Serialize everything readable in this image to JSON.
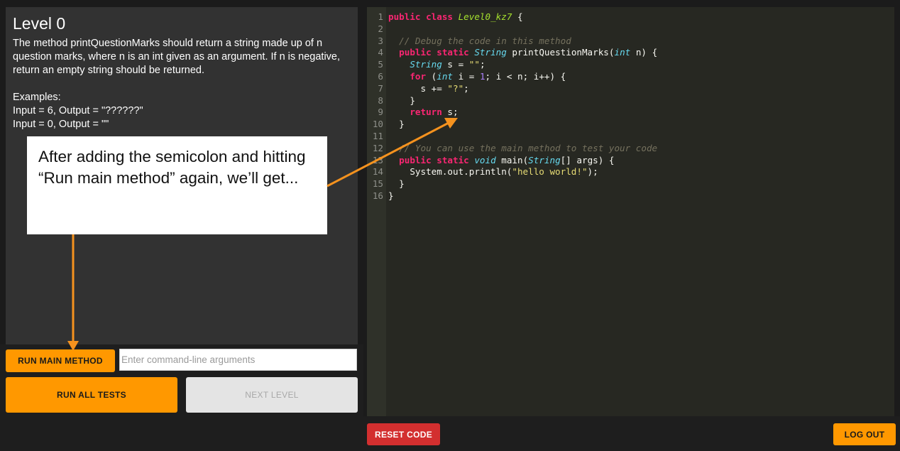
{
  "level": {
    "title": "Level 0",
    "description": "The method printQuestionMarks should return a string made up of n question marks, where n is an int given as an argument. If n is negative, return an empty string should be returned.\n\nExamples:\nInput = 6, Output = \"??????\"\nInput = 0, Output = \"\""
  },
  "controls": {
    "run_main_label": "RUN MAIN METHOD",
    "args_placeholder": "Enter command-line arguments",
    "run_tests_label": "RUN ALL TESTS",
    "next_level_label": "NEXT LEVEL"
  },
  "editor": {
    "lines": [
      {
        "n": "1",
        "tokens": [
          [
            "kw",
            "public "
          ],
          [
            "kw",
            "class "
          ],
          [
            "cl",
            "Level0_kz7"
          ],
          [
            "pl",
            " {"
          ]
        ]
      },
      {
        "n": "2",
        "tokens": []
      },
      {
        "n": "3",
        "tokens": [
          [
            "pl",
            "  "
          ],
          [
            "cm",
            "// Debug the code in this method"
          ]
        ]
      },
      {
        "n": "4",
        "tokens": [
          [
            "pl",
            "  "
          ],
          [
            "kw",
            "public "
          ],
          [
            "kw",
            "static "
          ],
          [
            "ty",
            "String"
          ],
          [
            "pl",
            " printQuestionMarks("
          ],
          [
            "ty",
            "int"
          ],
          [
            "pl",
            " n) {"
          ]
        ]
      },
      {
        "n": "5",
        "tokens": [
          [
            "pl",
            "    "
          ],
          [
            "ty",
            "String"
          ],
          [
            "pl",
            " s = "
          ],
          [
            "st",
            "\"\""
          ],
          [
            "pl",
            ";"
          ]
        ]
      },
      {
        "n": "6",
        "tokens": [
          [
            "pl",
            "    "
          ],
          [
            "kw",
            "for"
          ],
          [
            "pl",
            " ("
          ],
          [
            "ty",
            "int"
          ],
          [
            "pl",
            " i = "
          ],
          [
            "nu",
            "1"
          ],
          [
            "pl",
            "; i < n; i++) {"
          ]
        ]
      },
      {
        "n": "7",
        "tokens": [
          [
            "pl",
            "      s += "
          ],
          [
            "st",
            "\"?\""
          ],
          [
            "pl",
            ";"
          ]
        ]
      },
      {
        "n": "8",
        "tokens": [
          [
            "pl",
            "    }"
          ]
        ]
      },
      {
        "n": "9",
        "tokens": [
          [
            "pl",
            "    "
          ],
          [
            "kw",
            "return"
          ],
          [
            "pl",
            " s;"
          ]
        ]
      },
      {
        "n": "10",
        "tokens": [
          [
            "pl",
            "  }"
          ]
        ]
      },
      {
        "n": "11",
        "tokens": []
      },
      {
        "n": "12",
        "tokens": [
          [
            "pl",
            "  "
          ],
          [
            "cm",
            "// You can use the main method to test your code"
          ]
        ]
      },
      {
        "n": "13",
        "tokens": [
          [
            "pl",
            "  "
          ],
          [
            "kw",
            "public "
          ],
          [
            "kw",
            "static "
          ],
          [
            "ty",
            "void"
          ],
          [
            "pl",
            " main("
          ],
          [
            "ty",
            "String"
          ],
          [
            "pl",
            "[] args) {"
          ]
        ]
      },
      {
        "n": "14",
        "tokens": [
          [
            "pl",
            "    System.out.println("
          ],
          [
            "st",
            "\"hello world!\""
          ],
          [
            "pl",
            ");"
          ]
        ]
      },
      {
        "n": "15",
        "tokens": [
          [
            "pl",
            "  }"
          ]
        ]
      },
      {
        "n": "16",
        "tokens": [
          [
            "pl",
            "}"
          ]
        ]
      }
    ]
  },
  "bottom": {
    "reset_label": "RESET CODE",
    "logout_label": "LOG OUT"
  },
  "annotation": {
    "text": "After adding the semicolon and hitting “Run main method” again, we’ll get..."
  },
  "colors": {
    "accent": "#ff9800",
    "danger": "#d32f2f",
    "panel": "#323232",
    "editor_bg": "#272822"
  }
}
